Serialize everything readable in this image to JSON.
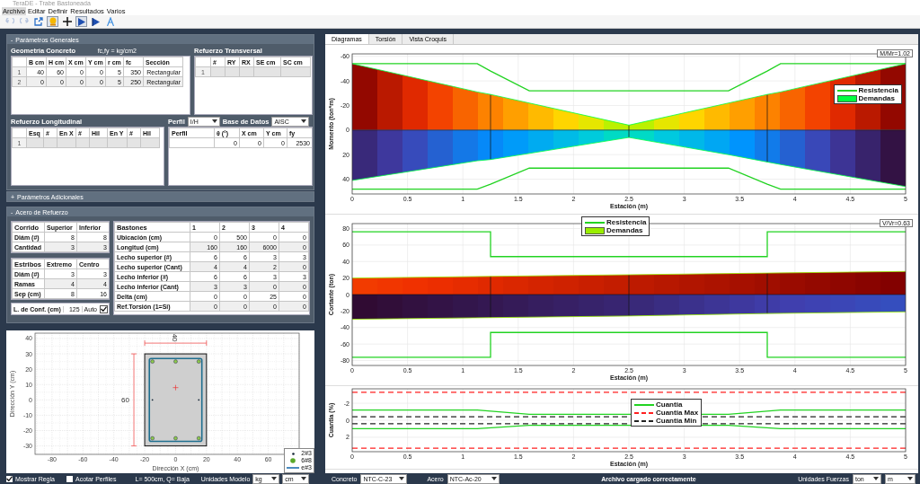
{
  "window": {
    "title": "TeraDE - Trabe Bastoneada"
  },
  "menu": [
    {
      "label": "Archivo",
      "selected": true
    },
    {
      "label": "Editar",
      "selected": false
    },
    {
      "label": "Definir",
      "selected": false
    },
    {
      "label": "Resultados",
      "selected": false
    },
    {
      "label": "Varios",
      "selected": false
    }
  ],
  "toolbar": [
    {
      "kind": "undo",
      "disabled": true,
      "selected": false
    },
    {
      "kind": "redo",
      "disabled": true,
      "selected": false
    },
    {
      "kind": "export",
      "disabled": false,
      "selected": false
    },
    {
      "kind": "lamp",
      "disabled": false,
      "selected": true
    },
    {
      "kind": "plus",
      "disabled": false,
      "selected": false
    },
    {
      "kind": "play",
      "disabled": false,
      "selected": true
    },
    {
      "kind": "play-flag",
      "disabled": false,
      "selected": false
    },
    {
      "kind": "peak",
      "disabled": false,
      "selected": false
    }
  ],
  "general_params": {
    "toggle": "-",
    "title": "Parámetros Generales",
    "geometry": {
      "title": "Geometría Concreto",
      "note": "fc,fy = kg/cm2",
      "columns": [
        "B cm",
        "H cm",
        "X cm",
        "Y cm",
        "r cm",
        "fc",
        "Sección"
      ],
      "rows": [
        {
          "index": "1",
          "cells": [
            "40",
            "60",
            "0",
            "0",
            "5",
            "350",
            "Rectangular"
          ]
        },
        {
          "index": "2",
          "cells": [
            "0",
            "0",
            "0",
            "0",
            "5",
            "250",
            "Rectangular"
          ]
        }
      ]
    },
    "transverse": {
      "title": "Refuerzo Transversal",
      "columns": [
        "#",
        "RY",
        "RX",
        "SE cm",
        "SC cm"
      ],
      "rows": [
        {
          "index": "1"
        }
      ]
    },
    "longitudinal": {
      "title": "Refuerzo Longitudinal",
      "columns": [
        "Esq",
        "#",
        "En X",
        "#",
        "Hil",
        "En Y",
        "#",
        "Hil"
      ],
      "rows": [
        {
          "index": "1"
        }
      ]
    },
    "profile": {
      "label": "Perfil",
      "value": "I/H",
      "db_label": "Base de Datos",
      "db_value": "AISC",
      "columns": [
        "Perfil",
        "θ (°)",
        "X cm",
        "Y cm",
        "fy"
      ],
      "rows": [
        {
          "cells": [
            null,
            "0",
            "0",
            "0",
            "2530"
          ]
        }
      ]
    }
  },
  "additional_params": {
    "toggle": "+",
    "title": "Parámetros Adicionales"
  },
  "rebar": {
    "toggle": "-",
    "title": "Acero de Refuerzo",
    "continuous": {
      "title": "Corrido",
      "columns": [
        "Superior",
        "Inferior"
      ],
      "rows": [
        {
          "label": "Diám (#)",
          "cells": [
            "8",
            "8"
          ]
        },
        {
          "label": "Cantidad",
          "cells": [
            "3",
            "3"
          ]
        }
      ]
    },
    "stirrups": {
      "title": "Estribos",
      "columns": [
        "Extremo",
        "Centro"
      ],
      "rows": [
        {
          "label": "Diám (#)",
          "cells": [
            "3",
            "3"
          ]
        },
        {
          "label": "Ramas",
          "cells": [
            "4",
            "4"
          ]
        },
        {
          "label": "Sep (cm)",
          "cells": [
            "8",
            "16"
          ]
        }
      ]
    },
    "confinement": {
      "label": "L. de Conf. (cm)",
      "value": "125",
      "auto_label": "Auto",
      "auto": true
    },
    "bars": {
      "title": "Bastones",
      "columns": [
        "1",
        "2",
        "3",
        "4"
      ],
      "rows": [
        {
          "label": "Ubicación (cm)",
          "cells": [
            "0",
            "500",
            "0",
            "0"
          ]
        },
        {
          "label": "Longitud (cm)",
          "cells": [
            "160",
            "160",
            "6000",
            "0"
          ]
        },
        {
          "label": "Lecho superior (#)",
          "cells": [
            "6",
            "6",
            "3",
            "3"
          ]
        },
        {
          "label": "Lecho superior (Cant)",
          "cells": [
            "4",
            "4",
            "2",
            "0"
          ]
        },
        {
          "label": "Lecho inferior (#)",
          "cells": [
            "6",
            "6",
            "3",
            "3"
          ]
        },
        {
          "label": "Lecho inferior (Cant)",
          "cells": [
            "3",
            "3",
            "0",
            "0"
          ]
        },
        {
          "label": "Delta (cm)",
          "cells": [
            "0",
            "0",
            "25",
            "0"
          ]
        },
        {
          "label": "Ref.Torsión (1=Si)",
          "cells": [
            "0",
            "0",
            "0",
            "0"
          ]
        }
      ]
    }
  },
  "section_view": {
    "xlabel": "Dirección X (cm)",
    "ylabel": "Dirección Y (cm)",
    "xticks": [
      "-80",
      "-60",
      "-40",
      "-20",
      "0",
      "20",
      "40",
      "60"
    ],
    "yticks": [
      "40",
      "30",
      "20",
      "10",
      "0",
      "-10",
      "-20",
      "-30"
    ],
    "width_label": "40",
    "height_label": "60",
    "legend": [
      {
        "label": "2#3",
        "kind": "dot"
      },
      {
        "label": "6#8",
        "kind": "bar"
      },
      {
        "label": "e#3",
        "kind": "stirrup"
      }
    ]
  },
  "left_footer": {
    "ruler": {
      "label": "Mostrar Regla",
      "checked": true
    },
    "dims": {
      "label": "Acotar Perfiles",
      "checked": false
    },
    "info": "L= 500cm, Q= Baja",
    "units_label": "Unidades Modelo",
    "units": [
      "kg",
      "cm"
    ]
  },
  "tabs": [
    {
      "label": "Diagramas",
      "selected": true
    },
    {
      "label": "Torsión",
      "selected": false
    },
    {
      "label": "Vista Croquis",
      "selected": false
    }
  ],
  "charts": [
    {
      "ratio_label": "M/Mr=1.02",
      "chart_data": {
        "type": "line",
        "xlabel": "Estación (m)",
        "ylabel": "Momento (ton*m)",
        "x": [
          0,
          1.13,
          1.25,
          1.6,
          2.5,
          3.4,
          3.75,
          3.87,
          5
        ],
        "xlim": [
          0,
          5
        ],
        "ylim": [
          52,
          -62
        ],
        "xticks": [
          0,
          0.5,
          1,
          1.5,
          2,
          2.5,
          3,
          3.5,
          4,
          4.5,
          5
        ],
        "yticks": [
          -60,
          -40,
          -20,
          0,
          20,
          40
        ],
        "grid": true,
        "legend": "upper right",
        "series": [
          {
            "name": "Resistencia",
            "color": "#22d322",
            "type": "line",
            "values": [
              -54,
              -54,
              -48,
              -32,
              -32,
              -32,
              -48,
              -54,
              -54
            ]
          },
          {
            "color": "#22d322",
            "type": "line",
            "values": [
              48,
              48,
              44,
              31,
              31,
              31,
              44,
              48,
              48
            ]
          },
          {
            "name": "Demandas",
            "color": "#00ff40",
            "type": "area",
            "values": [
              -54,
              -31,
              -29,
              -22,
              -4,
              -22,
              -29,
              -31,
              -54
            ]
          },
          {
            "color": "#00ff40",
            "type": "area",
            "values": [
              41,
              25,
              24,
              19,
              6,
              20,
              26,
              28,
              46
            ]
          }
        ]
      }
    },
    {
      "ratio_label": "V/Vr=0.63",
      "chart_data": {
        "type": "line",
        "xlabel": "Estación (m)",
        "ylabel": "Cortante (ton)",
        "x": [
          0,
          1.25,
          1.25,
          2.5,
          3.75,
          3.75,
          5
        ],
        "xlim": [
          0,
          5
        ],
        "ylim": [
          -86,
          86
        ],
        "xticks": [
          0,
          0.5,
          1,
          1.5,
          2,
          2.5,
          3,
          3.5,
          4,
          4.5,
          5
        ],
        "yticks": [
          80,
          60,
          40,
          20,
          0,
          -20,
          -40,
          -60,
          -80
        ],
        "grid": true,
        "legend": "upper center",
        "series": [
          {
            "name": "Resistencia",
            "color": "#22d322",
            "type": "line",
            "values": [
              76,
              76,
              46,
              46,
              46,
              76,
              76
            ]
          },
          {
            "color": "#22d322",
            "type": "line",
            "values": [
              -76,
              -76,
              -46,
              -46,
              -46,
              -76,
              -76
            ]
          },
          {
            "name": "Demandas",
            "color": "#99ee00",
            "type": "area",
            "values": [
              20,
              22,
              22,
              24,
              26,
              26,
              28
            ]
          },
          {
            "color": "#99ee00",
            "type": "area",
            "values": [
              -30,
              -28,
              -28,
              -26,
              -23,
              -23,
              -21
            ]
          }
        ]
      }
    },
    {
      "chart_data": {
        "type": "line",
        "xlabel": "Estación (m)",
        "ylabel": "Cuantia (%)",
        "x": [
          0,
          1.13,
          1.6,
          3.4,
          3.87,
          5
        ],
        "xlim": [
          0,
          5
        ],
        "ylim": [
          3.7,
          -3.7
        ],
        "xticks": [
          0,
          0.5,
          1,
          1.5,
          2,
          2.5,
          3,
          3.5,
          4,
          4.5,
          5
        ],
        "yticks": [
          -2,
          0,
          2
        ],
        "grid": true,
        "legend": "center",
        "series": [
          {
            "name": "Cuantia",
            "color": "#22d322",
            "type": "line",
            "values": [
              -1.2,
              -1.2,
              -0.7,
              -0.7,
              -1.2,
              -1.2
            ]
          },
          {
            "color": "#22d322",
            "type": "line",
            "values": [
              1,
              1,
              0.6,
              0.6,
              1,
              1
            ]
          }
        ],
        "ref_lines": [
          {
            "axis": "y",
            "value": -3.3,
            "color": "#ff2020",
            "label": "Cuantia Max"
          },
          {
            "axis": "y",
            "value": 3.3,
            "color": "#ff2020"
          },
          {
            "axis": "y",
            "value": -0.4,
            "color": "#222222",
            "label": "Cuantia Min"
          },
          {
            "axis": "y",
            "value": 0.4,
            "color": "#222222"
          }
        ]
      }
    }
  ],
  "status_bar": {
    "concrete_label": "Concreto",
    "concrete": "NTC-C-23",
    "steel_label": "Acero",
    "steel": "NTC-Ac-20",
    "message": "Archivo cargado correctamente",
    "units_label": "Unidades Fuerzas",
    "units": [
      "ton",
      "m"
    ]
  }
}
